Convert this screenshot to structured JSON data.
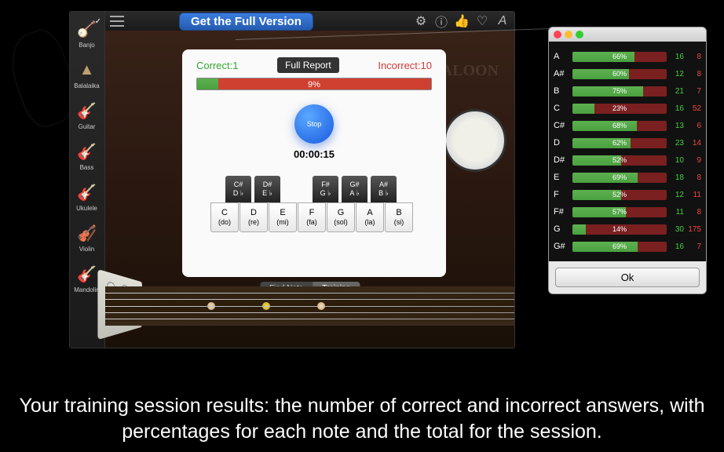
{
  "topbar": {
    "full_version": "Get the Full Version"
  },
  "instruments": [
    {
      "label": "Banjo",
      "selected": true
    },
    {
      "label": "Balalaika",
      "selected": false
    },
    {
      "label": "Guitar",
      "selected": false
    },
    {
      "label": "Bass",
      "selected": false
    },
    {
      "label": "Ukulele",
      "selected": false
    },
    {
      "label": "Violin",
      "selected": false
    },
    {
      "label": "Mandolin",
      "selected": false
    }
  ],
  "panel": {
    "correct_label": "Correct:1",
    "incorrect_label": "Incorrect:10",
    "report_btn": "Full Report",
    "progress_pct": "9%",
    "stop": "Stop",
    "timer": "00:00:15"
  },
  "black_keys": [
    {
      "sharp": "C#",
      "flat": "D ♭"
    },
    {
      "sharp": "D#",
      "flat": "E ♭"
    },
    {
      "sharp": "F#",
      "flat": "G ♭"
    },
    {
      "sharp": "G#",
      "flat": "A ♭"
    },
    {
      "sharp": "A#",
      "flat": "B ♭"
    }
  ],
  "white_keys": [
    {
      "note": "C",
      "solf": "(do)"
    },
    {
      "note": "D",
      "solf": "(re)"
    },
    {
      "note": "E",
      "solf": "(mi)"
    },
    {
      "note": "F",
      "solf": "(fa)"
    },
    {
      "note": "G",
      "solf": "(sol)"
    },
    {
      "note": "A",
      "solf": "(la)"
    },
    {
      "note": "B",
      "solf": "(si)"
    }
  ],
  "mode": {
    "find_note": "Find Note",
    "training": "Training"
  },
  "report": {
    "rows": [
      {
        "note": "A",
        "pct": 66,
        "good": 16,
        "bad": 8
      },
      {
        "note": "A#",
        "pct": 60,
        "good": 12,
        "bad": 8
      },
      {
        "note": "B",
        "pct": 75,
        "good": 21,
        "bad": 7
      },
      {
        "note": "C",
        "pct": 23,
        "good": 16,
        "bad": 52
      },
      {
        "note": "C#",
        "pct": 68,
        "good": 13,
        "bad": 6
      },
      {
        "note": "D",
        "pct": 62,
        "good": 23,
        "bad": 14
      },
      {
        "note": "D#",
        "pct": 52,
        "good": 10,
        "bad": 9
      },
      {
        "note": "E",
        "pct": 69,
        "good": 18,
        "bad": 8
      },
      {
        "note": "F",
        "pct": 52,
        "good": 12,
        "bad": 11
      },
      {
        "note": "F#",
        "pct": 57,
        "good": 11,
        "bad": 8
      },
      {
        "note": "G",
        "pct": 14,
        "good": 30,
        "bad": 175
      },
      {
        "note": "G#",
        "pct": 69,
        "good": 16,
        "bad": 7
      }
    ],
    "ok": "Ok"
  },
  "caption": "Your training session results: the number of correct and incorrect answers, with percentages for each note and the total for the session."
}
